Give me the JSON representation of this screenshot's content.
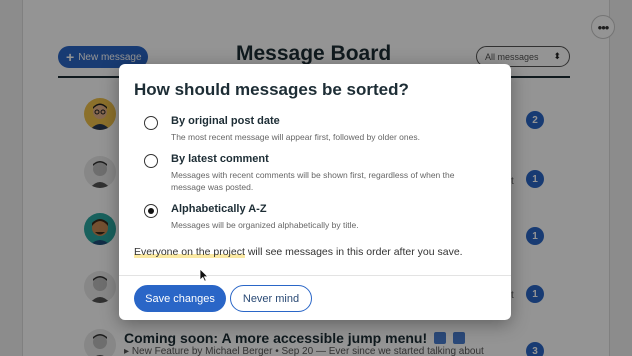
{
  "board": {
    "title": "Message Board",
    "new_message_label": "New message",
    "sort_select_value": "All messages",
    "more_button": "•••"
  },
  "rows": [
    {
      "count": "2"
    },
    {
      "count": "1"
    },
    {
      "count": "1"
    },
    {
      "count": "1"
    },
    {
      "count": "3",
      "title": "Coming soon: A more accessible jump menu!",
      "meta": "New Feature by Michael Berger • Sep 20 — Ever since we started talking about"
    }
  ],
  "side_snippets": [
    "t",
    "t"
  ],
  "dialog": {
    "title": "How should messages be sorted?",
    "options": [
      {
        "label": "By original post date",
        "description": "The most recent message will appear first, followed by older ones.",
        "checked": false
      },
      {
        "label": "By latest comment",
        "description": "Messages with recent comments will be shown first, regardless of when the message was posted.",
        "checked": false
      },
      {
        "label": "Alphabetically A-Z",
        "description": "Messages will be organized alphabetically by title.",
        "checked": true
      }
    ],
    "note_highlight": "Everyone on the project",
    "note_rest": " will see messages in this order after you save.",
    "save_label": "Save changes",
    "cancel_label": "Never mind"
  },
  "colors": {
    "accent": "#2a66c7",
    "title": "#1d2d35",
    "highlight": "#fbe9a3"
  }
}
